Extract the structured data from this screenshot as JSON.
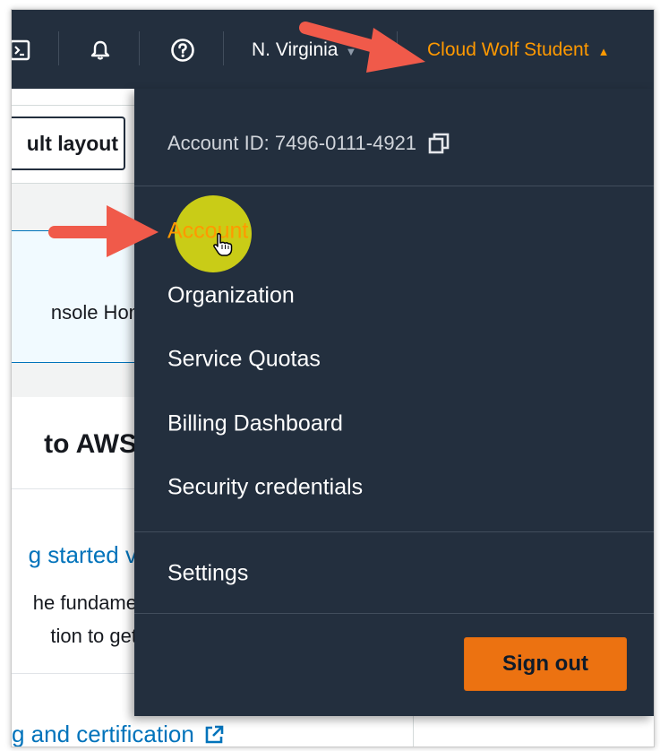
{
  "topbar": {
    "icons": [
      "cloudshell-icon",
      "bell-icon",
      "help-icon"
    ],
    "region": "N. Virginia",
    "user_name": "Cloud Wolf Student"
  },
  "background_page": {
    "layout_button": "ult layout",
    "info_text": "nsole Hom",
    "heading": "to AWS",
    "link_started": "g started v",
    "text_line1": "he fundame",
    "text_line2": "tion to get",
    "link_certification": "g and certification"
  },
  "dropdown": {
    "account_id": "Account ID: 7496-0111-4921",
    "items": [
      {
        "label": "Account",
        "active": true
      },
      {
        "label": "Organization",
        "active": false
      },
      {
        "label": "Service Quotas",
        "active": false
      },
      {
        "label": "Billing Dashboard",
        "active": false
      },
      {
        "label": "Security credentials",
        "active": false
      }
    ],
    "settings": "Settings",
    "sign_out": "Sign out"
  },
  "colors": {
    "nav_bg": "#232f3e",
    "accent_orange": "#ff9900",
    "sign_out_bg": "#ec7211",
    "link_blue": "#0073bb",
    "highlight": "#d8da14",
    "annotation_arrow": "#f05a4a"
  }
}
